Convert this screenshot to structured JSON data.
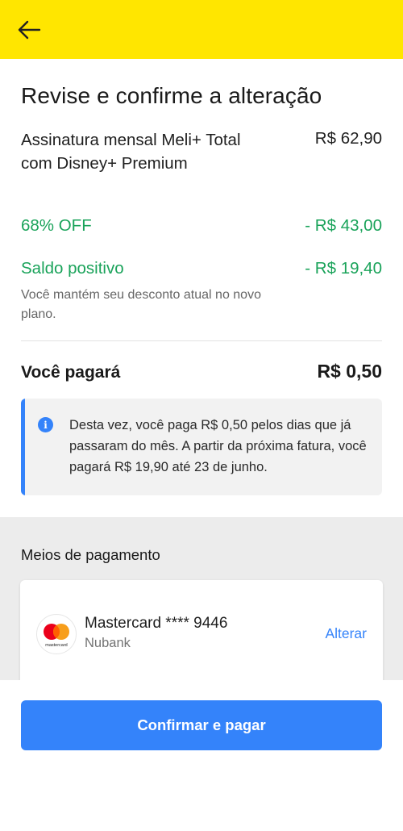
{
  "header": {
    "back_icon": "arrow-left-icon",
    "color": "#ffe600"
  },
  "page": {
    "title": "Revise e confirme a alteração"
  },
  "summary": {
    "plan_name": "Assinatura mensal Meli+ Total com Disney+ Premium",
    "plan_price": "R$ 62,90",
    "discount_label": "68% OFF",
    "discount_value": "- R$ 43,00",
    "credit_label": "Saldo positivo",
    "credit_value": "- R$ 19,40",
    "credit_note": "Você mantém seu desconto atual no novo plano.",
    "total_label": "Você pagará",
    "total_value": "R$ 0,50"
  },
  "info": {
    "icon": "info-icon",
    "text": "Desta vez, você paga R$ 0,50 pelos dias que já passaram do mês. A partir da próxima fatura, você pagará R$ 19,90 até 23 de junho."
  },
  "payment": {
    "section_title": "Meios de pagamento",
    "card_logo": "mastercard-icon",
    "card_logo_text": "mastercard",
    "card_name": "Mastercard **** 9446",
    "card_bank": "Nubank",
    "change_label": "Alterar"
  },
  "footer": {
    "confirm_label": "Confirmar e pagar"
  },
  "colors": {
    "accent": "#3483fa",
    "positive": "#1aa35a",
    "brand_yellow": "#ffe600"
  }
}
